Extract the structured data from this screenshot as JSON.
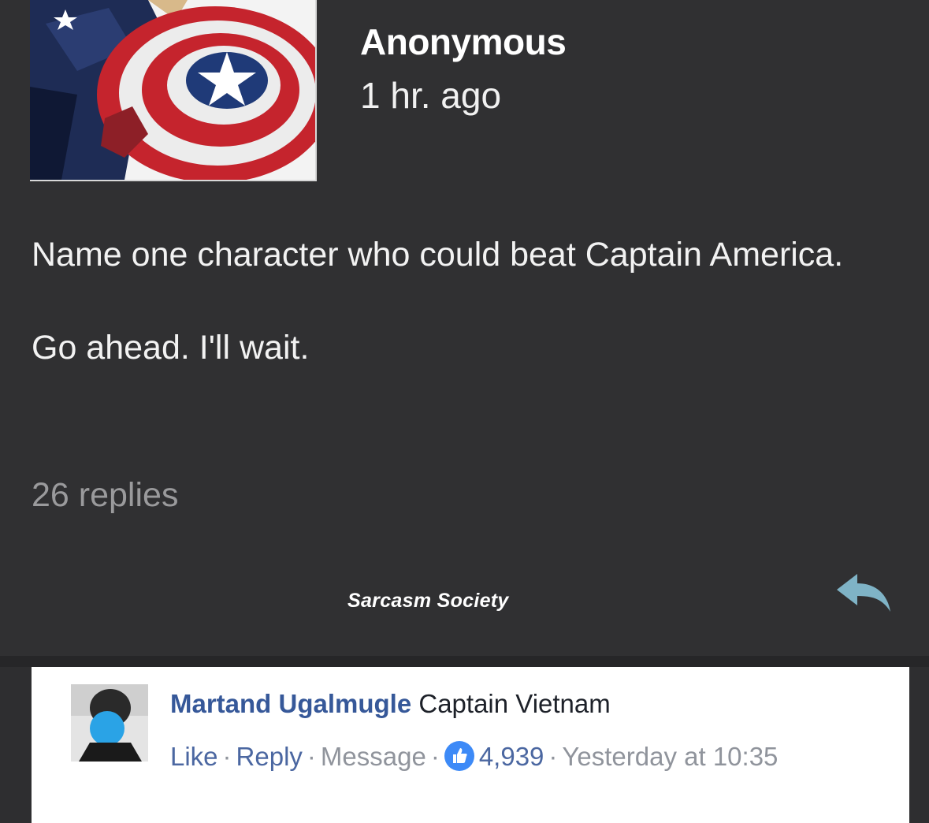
{
  "post": {
    "author": "Anonymous",
    "time": "1 hr. ago",
    "body_line1": "Name one character who could beat Captain America.",
    "body_line2": "Go ahead. I'll wait.",
    "replies": "26 replies"
  },
  "watermark": "Sarcasm Society",
  "comment": {
    "author": "Martand Ugalmugle",
    "text": "Captain Vietnam",
    "like": "Like",
    "reply": "Reply",
    "message": "Message",
    "likes": "4,939",
    "time": "Yesterday at 10:35"
  },
  "colors": {
    "background": "#303032",
    "link_blue": "#365899",
    "like_badge": "#3d8af7",
    "reply_arrow": "#7fb3c6"
  },
  "icons": [
    "captain-america-avatar-image",
    "reply-arrow-icon",
    "user-avatar-image",
    "like-thumb-icon"
  ]
}
